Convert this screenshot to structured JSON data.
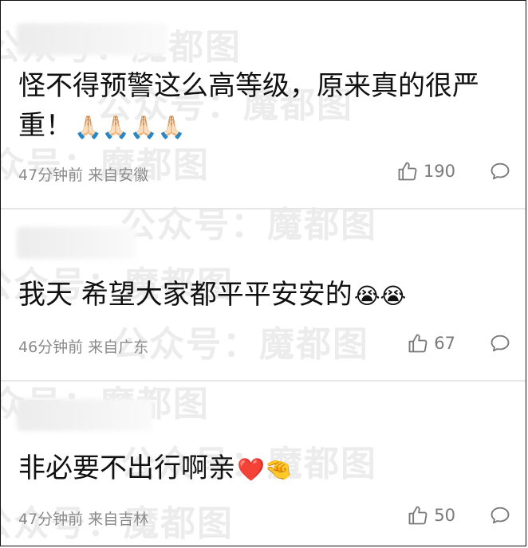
{
  "watermark": {
    "text": "公众号：魔都图"
  },
  "comments": [
    {
      "text": "怪不得预警这么高等级，原来真的很严重！",
      "emoji": "🙏🏻🙏🏻🙏🏻🙏🏻",
      "time": "47分钟前",
      "location": "来自安徽",
      "likes": "190"
    },
    {
      "text": "我天 希望大家都平平安安的",
      "emoji": "😭😭",
      "time": "46分钟前",
      "location": "来自广东",
      "likes": "67"
    },
    {
      "text": "非必要不出行啊亲",
      "emoji": "❤️🤏",
      "time": "47分钟前",
      "location": "来自吉林",
      "likes": "50"
    }
  ],
  "icons": {
    "like": "thumbs-up-icon",
    "reply": "comment-bubble-icon"
  }
}
